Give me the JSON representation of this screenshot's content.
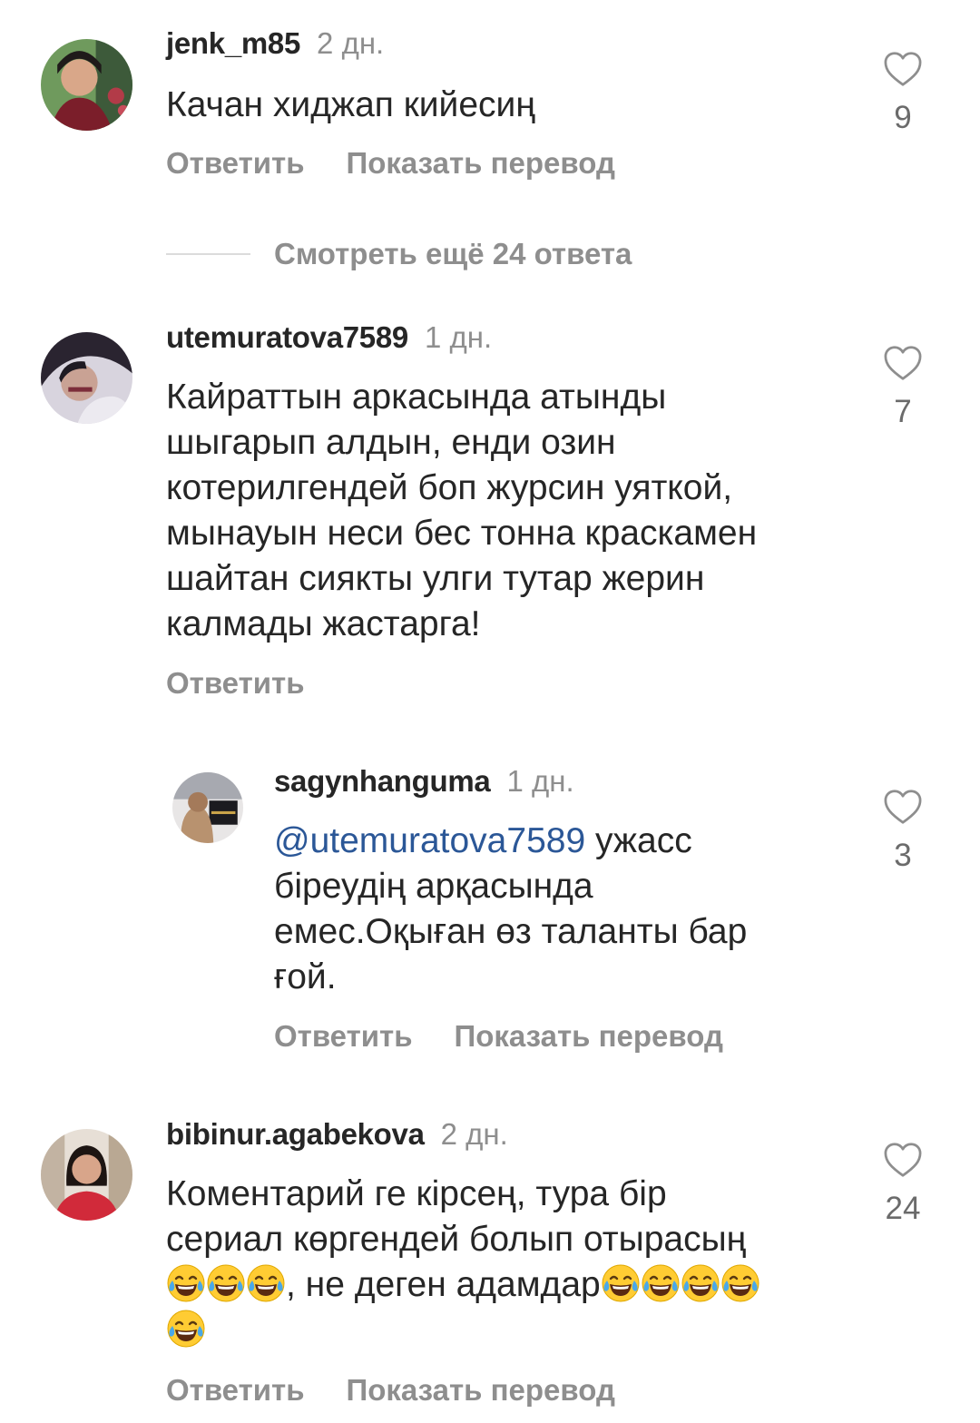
{
  "comments": [
    {
      "username": "jenk_m85",
      "time": "2 дн.",
      "text": "Качан хиджап кийесиң",
      "likes": "9",
      "actions": [
        "Ответить",
        "Показать перевод"
      ]
    },
    {
      "username": "utemuratova7589",
      "time": "1 дн.",
      "text_lines": [
        "Кайраттын аркасында атынды",
        "шыгарып алдын, енди озин",
        "котерилгендей боп журсин уяткой,",
        "мынауын неси бес тонна краскамен",
        "шайтан сиякты улги тутар жерин",
        "калмады жастарга!"
      ],
      "likes": "7",
      "actions": [
        "Ответить"
      ]
    },
    {
      "username": "sagynhanguma",
      "time": "1 дн.",
      "mention": "@utemuratova7589",
      "text_first": " ужасс",
      "text_lines": [
        "біреудің арқасында",
        "емес.Оқыған өз таланты бар",
        "ғой."
      ],
      "likes": "3",
      "actions": [
        "Ответить",
        "Показать перевод"
      ]
    },
    {
      "username": "bibinur.agabekova",
      "time": "2 дн.",
      "text_lines": [
        "Коментарий ге кірсең, тура бір",
        "сериал көргендей болып отырасың"
      ],
      "text_line3": ", не деген адамдар",
      "emoji": "😂",
      "likes": "24",
      "actions": [
        "Ответить",
        "Показать перевод"
      ]
    }
  ],
  "more_replies": "Смотреть ещё 24 ответа",
  "icons": {
    "like": "heart-outline-icon",
    "emoji": "face-with-tears-of-joy"
  },
  "colors": {
    "text": "#262626",
    "muted": "#8e8e8e",
    "mention": "#2b5797"
  }
}
